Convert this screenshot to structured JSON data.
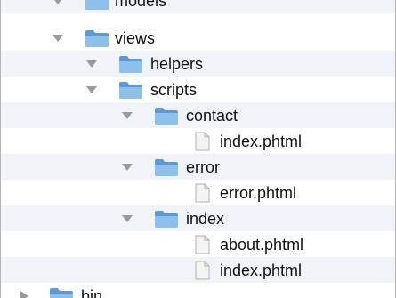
{
  "tree": {
    "items": [
      {
        "label": "models",
        "kind": "folder",
        "expanded": true
      },
      {
        "label": "views",
        "kind": "folder",
        "expanded": true
      },
      {
        "label": "helpers",
        "kind": "folder",
        "expanded": false
      },
      {
        "label": "scripts",
        "kind": "folder",
        "expanded": true
      },
      {
        "label": "contact",
        "kind": "folder",
        "expanded": true
      },
      {
        "label": "index.phtml",
        "kind": "file"
      },
      {
        "label": "error",
        "kind": "folder",
        "expanded": true
      },
      {
        "label": "error.phtml",
        "kind": "file"
      },
      {
        "label": "index",
        "kind": "folder",
        "expanded": true
      },
      {
        "label": "about.phtml",
        "kind": "file"
      },
      {
        "label": "index.phtml",
        "kind": "file"
      },
      {
        "label": "bin",
        "kind": "folder",
        "expanded": false
      }
    ]
  },
  "colors": {
    "folder_blue": "#6aa7de",
    "row_stripe": "#f0f3f8",
    "disclosure": "#9a9a9a"
  },
  "icons": {
    "folder": "folder-icon",
    "file": "file-icon",
    "expanded": "disclosure-down-icon",
    "collapsed": "disclosure-right-icon"
  }
}
